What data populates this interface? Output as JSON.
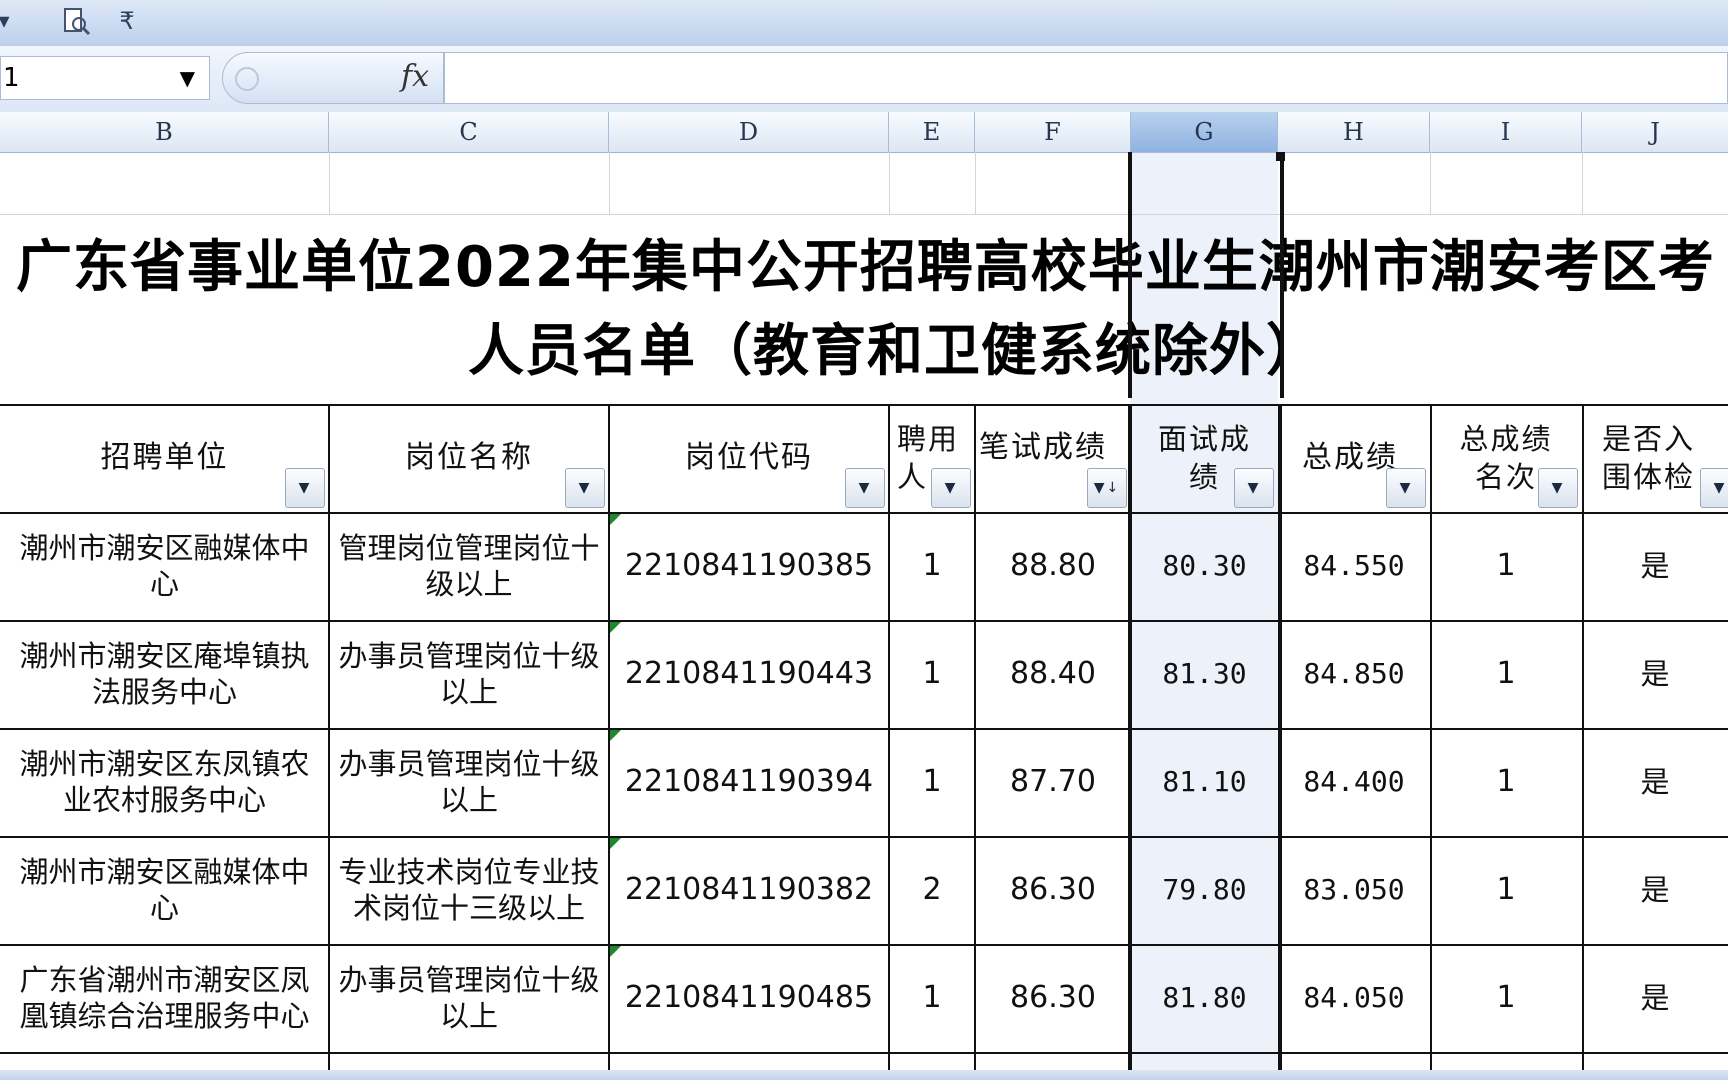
{
  "toolbar": {
    "print_preview_icon": "print-preview-icon",
    "customize_icon": "customize-qat-icon",
    "customize_glyph": "₹"
  },
  "formula_bar": {
    "name_box": "1",
    "fx_label": "fx",
    "formula": ""
  },
  "columns": [
    "B",
    "C",
    "D",
    "E",
    "F",
    "G",
    "H",
    "I",
    "J"
  ],
  "selected_column": "G",
  "title": {
    "line1": "广东省事业单位2022年集中公开招聘高校毕业生潮州市潮安考区考",
    "line2": "人员名单（教育和卫健系统除外）"
  },
  "table": {
    "headers": [
      [
        "招聘单位"
      ],
      [
        "岗位名称"
      ],
      [
        "岗位代码"
      ],
      [
        "聘用",
        "人"
      ],
      [
        "笔试成绩"
      ],
      [
        "面试成",
        "绩"
      ],
      [
        "总成绩"
      ],
      [
        "总成绩",
        "名次"
      ],
      [
        "是否入",
        "围体检"
      ]
    ],
    "rows": [
      [
        "潮州市潮安区融媒体中心",
        "管理岗位管理岗位十级以上",
        "2210841190385",
        "1",
        "88.80",
        "80.30",
        "84.550",
        "1",
        "是"
      ],
      [
        "潮州市潮安区庵埠镇执法服务中心",
        "办事员管理岗位十级以上",
        "2210841190443",
        "1",
        "88.40",
        "81.30",
        "84.850",
        "1",
        "是"
      ],
      [
        "潮州市潮安区东凤镇农业农村服务中心",
        "办事员管理岗位十级以上",
        "2210841190394",
        "1",
        "87.70",
        "81.10",
        "84.400",
        "1",
        "是"
      ],
      [
        "潮州市潮安区融媒体中心",
        "专业技术岗位专业技术岗位十三级以上",
        "2210841190382",
        "2",
        "86.30",
        "79.80",
        "83.050",
        "1",
        "是"
      ],
      [
        "广东省潮州市潮安区凤凰镇综合治理服务中心",
        "办事员管理岗位十级以上",
        "2210841190485",
        "1",
        "86.30",
        "81.80",
        "84.050",
        "1",
        "是"
      ]
    ]
  },
  "colors": {
    "header_bg": "#dce6f3",
    "selected_header": "#8fb2e0",
    "error_indicator": "#1d8a2a"
  }
}
